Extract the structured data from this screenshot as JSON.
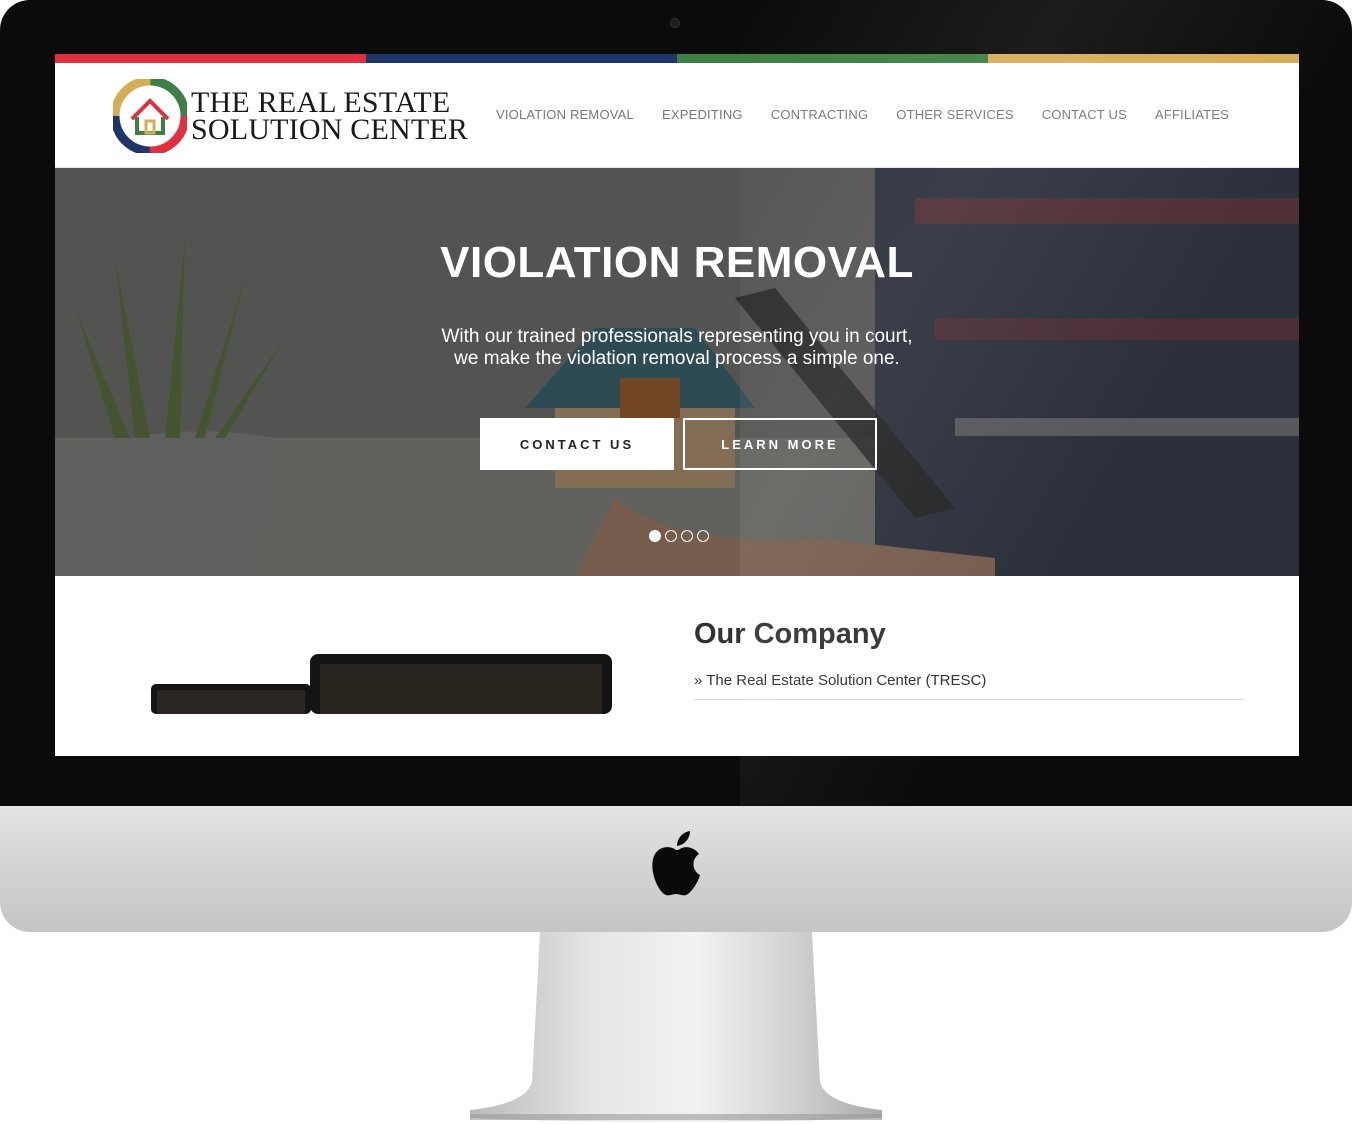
{
  "header": {
    "logo_line1": "THE REAL ESTATE",
    "logo_line2": "SOLUTION CENTER",
    "badge_text_top": "THE REAL ESTATE",
    "badge_text_bottom": "SOLUTION CENTER"
  },
  "nav": {
    "items": [
      "VIOLATION REMOVAL",
      "EXPEDITING",
      "CONTRACTING",
      "OTHER SERVICES",
      "CONTACT US",
      "AFFILIATES"
    ]
  },
  "colors": {
    "red": "#e0303d",
    "navy": "#1e3566",
    "green": "#3f7e44",
    "gold": "#d6ad57"
  },
  "hero": {
    "title": "VIOLATION REMOVAL",
    "subtitle_line1": "With our trained professionals representing you in court,",
    "subtitle_line2": "we make the violation removal process a simple one.",
    "contact_label": "CONTACT US",
    "learn_label": "LEARN MORE",
    "slide_count": 4,
    "active_slide": 1
  },
  "company": {
    "title": "Our Company",
    "item": "» The Real Estate Solution Center (TRESC)"
  },
  "icons": {
    "apple": "apple-logo-icon",
    "badge": "house-badge-icon"
  }
}
